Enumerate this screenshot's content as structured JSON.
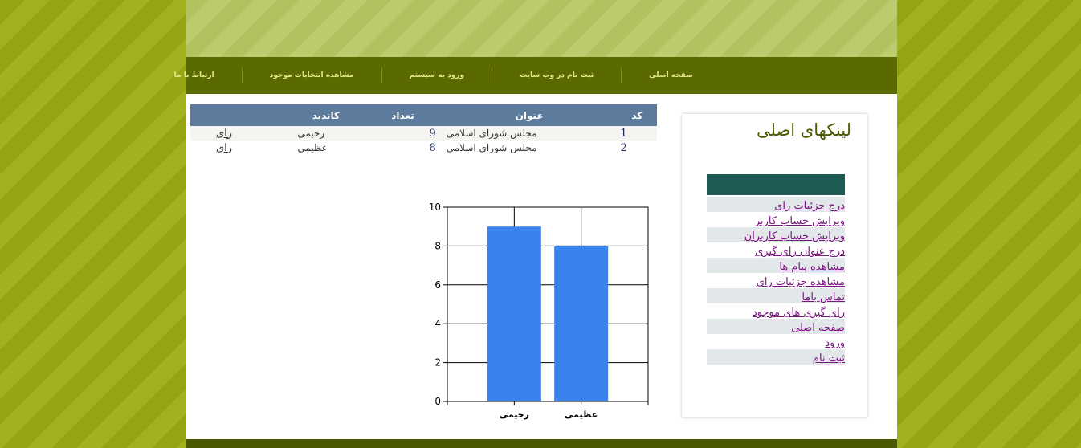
{
  "nav": {
    "items": [
      {
        "label": "صفحه اصلی"
      },
      {
        "label": "ثبت نام در وب سایت"
      },
      {
        "label": "ورود به سیستم"
      },
      {
        "label": "مشاهده انتخابات موجود"
      },
      {
        "label": "ارتباط با ما"
      }
    ]
  },
  "sidebar": {
    "title": "لینکهای اصلی",
    "links": [
      {
        "label": "درج جزئیات رای"
      },
      {
        "label": "ویرایش حساب کاربر"
      },
      {
        "label": "ویرایش حساب کاربران"
      },
      {
        "label": "درج عنوان رای گیری"
      },
      {
        "label": "مشاهده پیام ها"
      },
      {
        "label": "مشاهده جزئیات رای"
      },
      {
        "label": "تماس باما"
      },
      {
        "label": "رای گیری های موجود"
      },
      {
        "label": "صفحه اصلی"
      },
      {
        "label": "ورود"
      },
      {
        "label": "ثبت نام"
      }
    ]
  },
  "table": {
    "headers": {
      "code": "کد",
      "title": "عنوان",
      "count": "تعداد",
      "candidate": "کاندید",
      "vote": ""
    },
    "rows": [
      {
        "code": "1",
        "title": "مجلس شورای اسلامی",
        "count": "9",
        "candidate": "رحیمی",
        "vote": "رای"
      },
      {
        "code": "2",
        "title": "مجلس شورای اسلامی",
        "count": "8",
        "candidate": "عظیمی",
        "vote": "رای"
      }
    ]
  },
  "chart_data": {
    "type": "bar",
    "categories": [
      "رحیمی",
      "عظیمی"
    ],
    "values": [
      9,
      8
    ],
    "ylim": [
      0,
      10
    ],
    "yticks": [
      "0",
      "2",
      "4",
      "6",
      "8",
      "10"
    ],
    "grid": true,
    "bar_color": "#3a82ec"
  },
  "colors": {
    "background": "#95a512",
    "navbar": "#5a6a00",
    "table_header": "#5d7b9c",
    "sidebar_header": "#1e5b55",
    "link": "#7a1480"
  }
}
